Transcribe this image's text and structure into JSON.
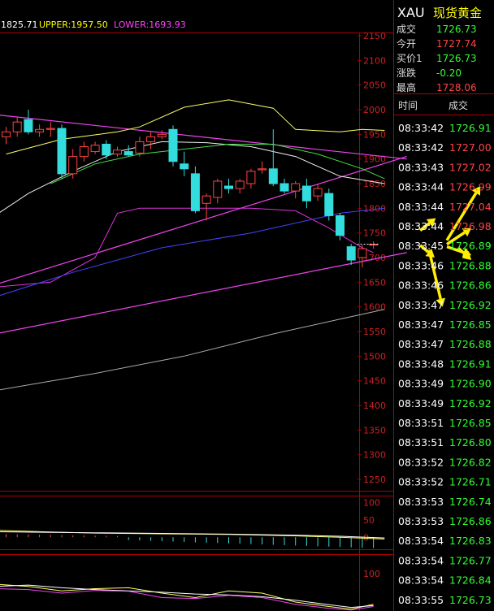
{
  "indicator_bar": {
    "mid_value": "1825.71",
    "upper_label": "UPPER:1957.50",
    "lower_label": "LOWER:1693.93",
    "mid_color": "#ffffff",
    "upper_color": "#ffff00",
    "lower_color": "#ff44ff"
  },
  "quote_panel": {
    "symbol": "XAU",
    "name": "现货黄金",
    "rows": [
      {
        "label": "成交",
        "value": "1726.73",
        "color": "#33ff33"
      },
      {
        "label": "今开",
        "value": "1727.74",
        "color": "#ff4444"
      },
      {
        "label": "买价1",
        "value": "1726.73",
        "color": "#33ff33"
      },
      {
        "label": "涨跌",
        "value": "-0.20",
        "color": "#33ff33"
      },
      {
        "label": "最高",
        "value": "1728.06",
        "color": "#ff4444"
      }
    ]
  },
  "ticks": {
    "header_time": "时间",
    "header_price": "成交",
    "rows": [
      {
        "time": "08:33:42",
        "price": "1726.91",
        "color": "#33ff33"
      },
      {
        "time": "08:33:42",
        "price": "1727.00",
        "color": "#ff4444"
      },
      {
        "time": "08:33:43",
        "price": "1727.02",
        "color": "#ff4444"
      },
      {
        "time": "08:33:44",
        "price": "1726.99",
        "color": "#ff4444"
      },
      {
        "time": "08:33:44",
        "price": "1727.04",
        "color": "#ff4444"
      },
      {
        "time": "08:33:44",
        "price": "1726.98",
        "color": "#ff4444"
      },
      {
        "time": "08:33:45",
        "price": "1726.89",
        "color": "#33ff33"
      },
      {
        "time": "08:33:46",
        "price": "1726.88",
        "color": "#33ff33"
      },
      {
        "time": "08:33:46",
        "price": "1726.86",
        "color": "#33ff33"
      },
      {
        "time": "08:33:47",
        "price": "1726.92",
        "color": "#33ff33"
      },
      {
        "time": "08:33:47",
        "price": "1726.85",
        "color": "#33ff33"
      },
      {
        "time": "08:33:47",
        "price": "1726.88",
        "color": "#33ff33"
      },
      {
        "time": "08:33:48",
        "price": "1726.91",
        "color": "#33ff33"
      },
      {
        "time": "08:33:49",
        "price": "1726.90",
        "color": "#33ff33"
      },
      {
        "time": "08:33:49",
        "price": "1726.92",
        "color": "#33ff33"
      },
      {
        "time": "08:33:51",
        "price": "1726.85",
        "color": "#33ff33"
      },
      {
        "time": "08:33:51",
        "price": "1726.80",
        "color": "#33ff33"
      },
      {
        "time": "08:33:52",
        "price": "1726.82",
        "color": "#33ff33"
      },
      {
        "time": "08:33:52",
        "price": "1726.71",
        "color": "#33ff33"
      },
      {
        "time": "08:33:53",
        "price": "1726.74",
        "color": "#33ff33"
      },
      {
        "time": "08:33:53",
        "price": "1726.86",
        "color": "#33ff33"
      },
      {
        "time": "08:33:54",
        "price": "1726.83",
        "color": "#33ff33"
      },
      {
        "time": "08:33:54",
        "price": "1726.77",
        "color": "#33ff33"
      },
      {
        "time": "08:33:54",
        "price": "1726.84",
        "color": "#33ff33"
      },
      {
        "time": "08:33:55",
        "price": "1726.73",
        "color": "#33ff33"
      }
    ]
  },
  "chart_data": {
    "type": "candlestick",
    "ylim": [
      1250,
      2150
    ],
    "y_ticks": [
      "2150",
      "2100",
      "2050",
      "2000",
      "1950",
      "1900",
      "1850",
      "1800",
      "1750",
      "1700",
      "1650",
      "1600",
      "1550",
      "1500",
      "1450",
      "1400",
      "1350",
      "1300",
      "1250"
    ],
    "up_color": "#ff4444",
    "down_color": "#33dddd",
    "candles": [
      {
        "o": 1945,
        "h": 1965,
        "l": 1930,
        "c": 1955
      },
      {
        "o": 1955,
        "h": 1985,
        "l": 1945,
        "c": 1975
      },
      {
        "o": 1980,
        "h": 2000,
        "l": 1950,
        "c": 1955
      },
      {
        "o": 1955,
        "h": 1970,
        "l": 1945,
        "c": 1960
      },
      {
        "o": 1960,
        "h": 1975,
        "l": 1945,
        "c": 1962
      },
      {
        "o": 1962,
        "h": 1970,
        "l": 1860,
        "c": 1870
      },
      {
        "o": 1870,
        "h": 1920,
        "l": 1860,
        "c": 1905
      },
      {
        "o": 1905,
        "h": 1935,
        "l": 1895,
        "c": 1925
      },
      {
        "o": 1915,
        "h": 1935,
        "l": 1910,
        "c": 1928
      },
      {
        "o": 1930,
        "h": 1938,
        "l": 1900,
        "c": 1908
      },
      {
        "o": 1910,
        "h": 1925,
        "l": 1905,
        "c": 1918
      },
      {
        "o": 1915,
        "h": 1928,
        "l": 1905,
        "c": 1908
      },
      {
        "o": 1912,
        "h": 1945,
        "l": 1905,
        "c": 1935
      },
      {
        "o": 1935,
        "h": 1955,
        "l": 1920,
        "c": 1945
      },
      {
        "o": 1945,
        "h": 1958,
        "l": 1940,
        "c": 1950
      },
      {
        "o": 1960,
        "h": 1968,
        "l": 1885,
        "c": 1895
      },
      {
        "o": 1890,
        "h": 1915,
        "l": 1865,
        "c": 1880
      },
      {
        "o": 1870,
        "h": 1885,
        "l": 1790,
        "c": 1795
      },
      {
        "o": 1810,
        "h": 1830,
        "l": 1775,
        "c": 1825
      },
      {
        "o": 1822,
        "h": 1860,
        "l": 1810,
        "c": 1855
      },
      {
        "o": 1845,
        "h": 1860,
        "l": 1830,
        "c": 1840
      },
      {
        "o": 1840,
        "h": 1860,
        "l": 1830,
        "c": 1855
      },
      {
        "o": 1850,
        "h": 1880,
        "l": 1840,
        "c": 1875
      },
      {
        "o": 1878,
        "h": 1895,
        "l": 1870,
        "c": 1880
      },
      {
        "o": 1880,
        "h": 1960,
        "l": 1845,
        "c": 1850
      },
      {
        "o": 1850,
        "h": 1860,
        "l": 1830,
        "c": 1835
      },
      {
        "o": 1835,
        "h": 1855,
        "l": 1820,
        "c": 1850
      },
      {
        "o": 1845,
        "h": 1860,
        "l": 1800,
        "c": 1815
      },
      {
        "o": 1825,
        "h": 1848,
        "l": 1815,
        "c": 1840
      },
      {
        "o": 1830,
        "h": 1840,
        "l": 1775,
        "c": 1785
      },
      {
        "o": 1785,
        "h": 1790,
        "l": 1735,
        "c": 1745
      },
      {
        "o": 1722,
        "h": 1728,
        "l": 1685,
        "c": 1695
      },
      {
        "o": 1700,
        "h": 1725,
        "l": 1680,
        "c": 1718
      },
      {
        "o": 1726,
        "h": 1733,
        "l": 1718,
        "c": 1727
      }
    ],
    "ma_lines": [
      {
        "color": "#ffff66",
        "points": [
          [
            0,
            1910
          ],
          [
            5,
            1940
          ],
          [
            10,
            1955
          ],
          [
            12,
            1965
          ],
          [
            16,
            2005
          ],
          [
            20,
            2020
          ],
          [
            24,
            2003
          ],
          [
            26,
            1960
          ],
          [
            30,
            1955
          ],
          [
            32,
            1960
          ],
          [
            34,
            1958
          ]
        ]
      },
      {
        "color": "#eeeeee",
        "points": [
          [
            -1,
            1785
          ],
          [
            2,
            1830
          ],
          [
            6,
            1875
          ],
          [
            10,
            1915
          ],
          [
            14,
            1935
          ],
          [
            18,
            1933
          ],
          [
            22,
            1925
          ],
          [
            26,
            1905
          ],
          [
            30,
            1865
          ],
          [
            34,
            1850
          ]
        ]
      },
      {
        "color": "#44dd44",
        "points": [
          [
            4,
            1850
          ],
          [
            8,
            1890
          ],
          [
            12,
            1910
          ],
          [
            16,
            1920
          ],
          [
            20,
            1930
          ],
          [
            24,
            1930
          ],
          [
            28,
            1910
          ],
          [
            32,
            1880
          ],
          [
            34,
            1860
          ]
        ]
      },
      {
        "color": "#dd33dd",
        "points": [
          [
            -1,
            1640
          ],
          [
            4,
            1650
          ],
          [
            8,
            1700
          ],
          [
            10,
            1790
          ],
          [
            12,
            1800
          ],
          [
            14,
            1800
          ],
          [
            18,
            1800
          ],
          [
            22,
            1800
          ],
          [
            26,
            1795
          ],
          [
            29,
            1760
          ],
          [
            32,
            1720
          ],
          [
            33,
            1710
          ]
        ]
      },
      {
        "color": "#4444ff",
        "points": [
          [
            -1,
            1620
          ],
          [
            6,
            1670
          ],
          [
            14,
            1720
          ],
          [
            22,
            1750
          ],
          [
            30,
            1790
          ],
          [
            34,
            1800
          ]
        ]
      },
      {
        "color": "#aaaaaa",
        "points": [
          [
            -1,
            1430
          ],
          [
            8,
            1465
          ],
          [
            16,
            1500
          ],
          [
            24,
            1545
          ],
          [
            30,
            1575
          ],
          [
            34,
            1595
          ]
        ]
      }
    ],
    "trend_lines": [
      {
        "color": "#ee44ee",
        "points": [
          [
            -1,
            1990
          ],
          [
            36,
            1900
          ]
        ]
      },
      {
        "color": "#ee44ee",
        "points": [
          [
            -1,
            1645
          ],
          [
            36,
            1905
          ]
        ]
      },
      {
        "color": "#ee44ee",
        "points": [
          [
            -1,
            1545
          ],
          [
            36,
            1710
          ]
        ]
      }
    ],
    "arrows": [
      {
        "from": [
          37.2,
          1755
        ],
        "to": [
          38.6,
          1780
        ]
      },
      {
        "from": [
          37.2,
          1725
        ],
        "to": [
          38.5,
          1700
        ]
      },
      {
        "from": [
          39.6,
          1727
        ],
        "to": [
          41.8,
          1760
        ]
      },
      {
        "from": [
          39.6,
          1722
        ],
        "to": [
          41.8,
          1705
        ]
      },
      {
        "from": [
          39.6,
          1735
        ],
        "to": [
          42.6,
          1845
        ]
      },
      {
        "from": [
          40.6,
          1720
        ],
        "to": [
          41.8,
          1695
        ]
      },
      {
        "from": [
          38.0,
          1715
        ],
        "to": [
          39.2,
          1600
        ]
      }
    ],
    "volume_panel": {
      "ylim": [
        -25,
        110
      ],
      "y_ticks": [
        "100",
        "50",
        "0"
      ]
    },
    "osc_panel": {
      "y_ticks": [
        "100"
      ]
    }
  }
}
